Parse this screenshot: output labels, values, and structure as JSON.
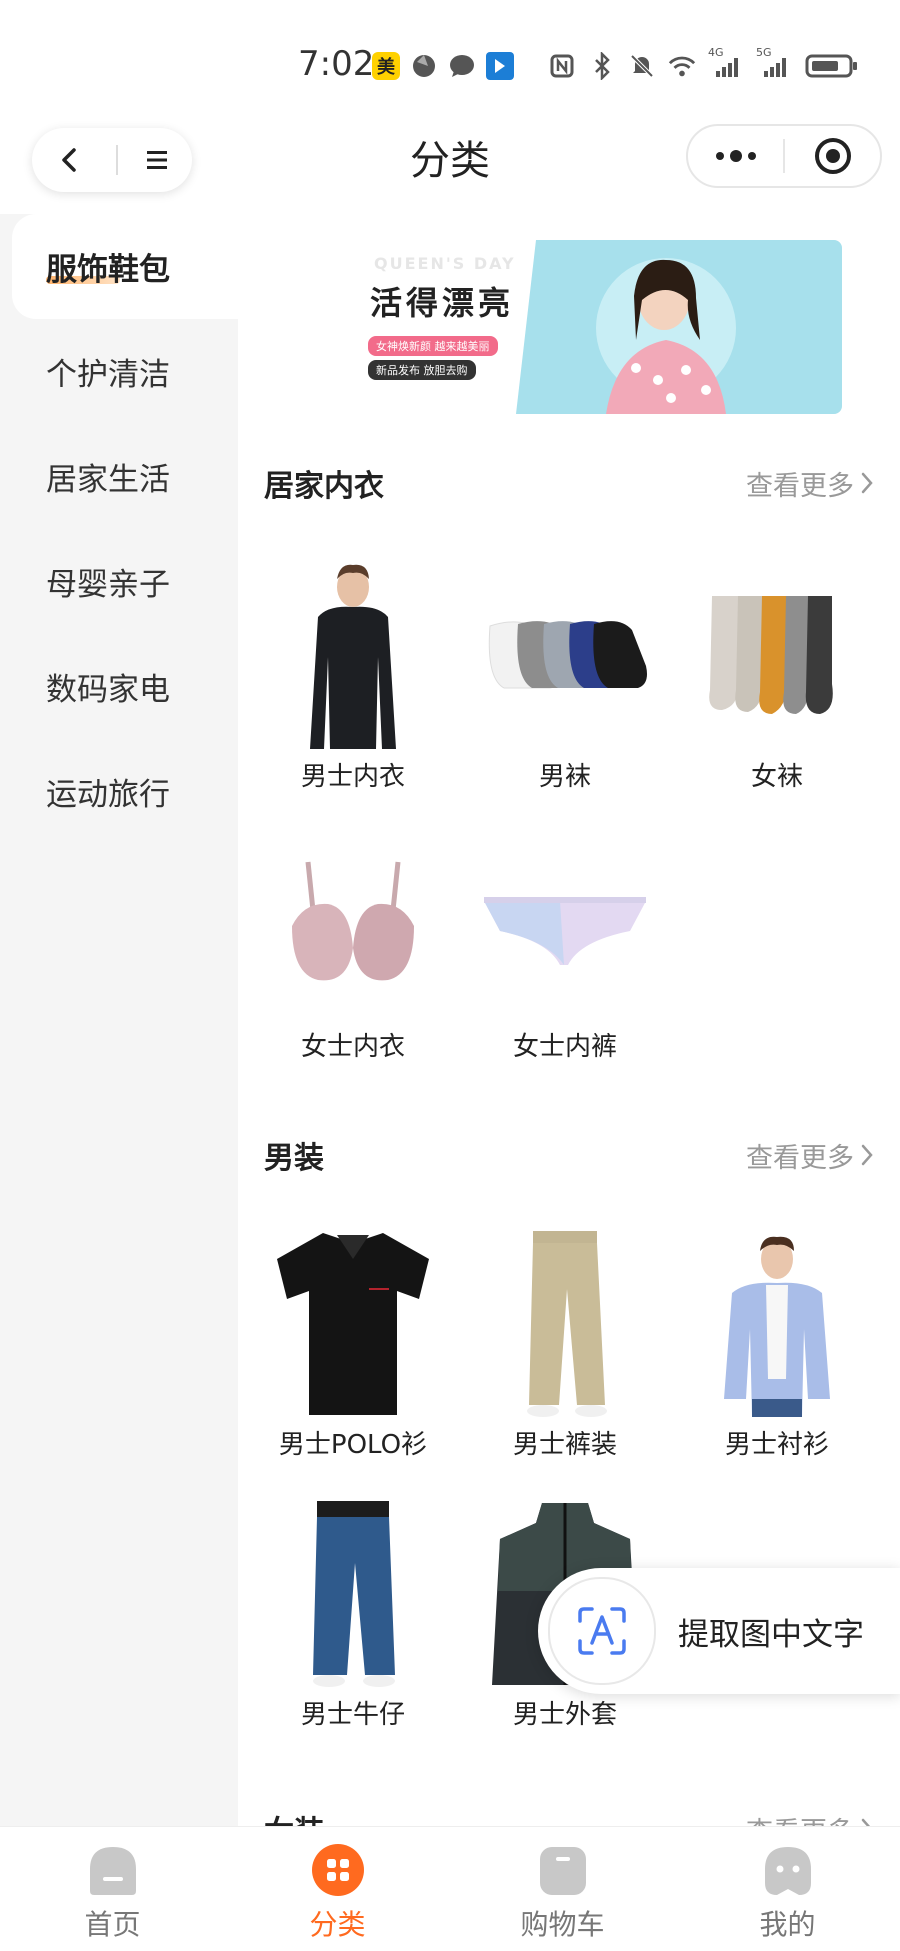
{
  "status_bar": {
    "time": "7:02",
    "meituan_badge": "美",
    "network": [
      "4G",
      "5G"
    ]
  },
  "header": {
    "title": "分类"
  },
  "sidebar": {
    "items": [
      {
        "label": "服饰鞋包",
        "active": true
      },
      {
        "label": "个护清洁",
        "active": false
      },
      {
        "label": "居家生活",
        "active": false
      },
      {
        "label": "母婴亲子",
        "active": false
      },
      {
        "label": "数码家电",
        "active": false
      },
      {
        "label": "运动旅行",
        "active": false
      }
    ]
  },
  "banner": {
    "bg_text": "QUEEN'S DAY",
    "headline": "活得漂亮",
    "tagline": "女神焕新颜 越来越美丽",
    "subline": "新品发布 放胆去购"
  },
  "sections": [
    {
      "title": "居家内衣",
      "more": "查看更多",
      "products": [
        "男士内衣",
        "男袜",
        "女袜",
        "女士内衣",
        "女士内裤"
      ]
    },
    {
      "title": "男装",
      "more": "查看更多",
      "products": [
        "男士POLO衫",
        "男士裤装",
        "男士衬衫",
        "男士牛仔",
        "男士外套"
      ]
    },
    {
      "title": "女装",
      "more": "查看更多"
    }
  ],
  "ocr_float": {
    "label": "提取图中文字"
  },
  "tabbar": {
    "items": [
      {
        "label": "首页",
        "icon": "home-icon"
      },
      {
        "label": "分类",
        "icon": "category-icon",
        "active": true
      },
      {
        "label": "购物车",
        "icon": "cart-icon"
      },
      {
        "label": "我的",
        "icon": "profile-icon"
      }
    ]
  },
  "colors": {
    "accent": "#ff6a1f",
    "sidebar_bg": "#f5f5f5",
    "tab_inactive": "#c8c8c8"
  }
}
